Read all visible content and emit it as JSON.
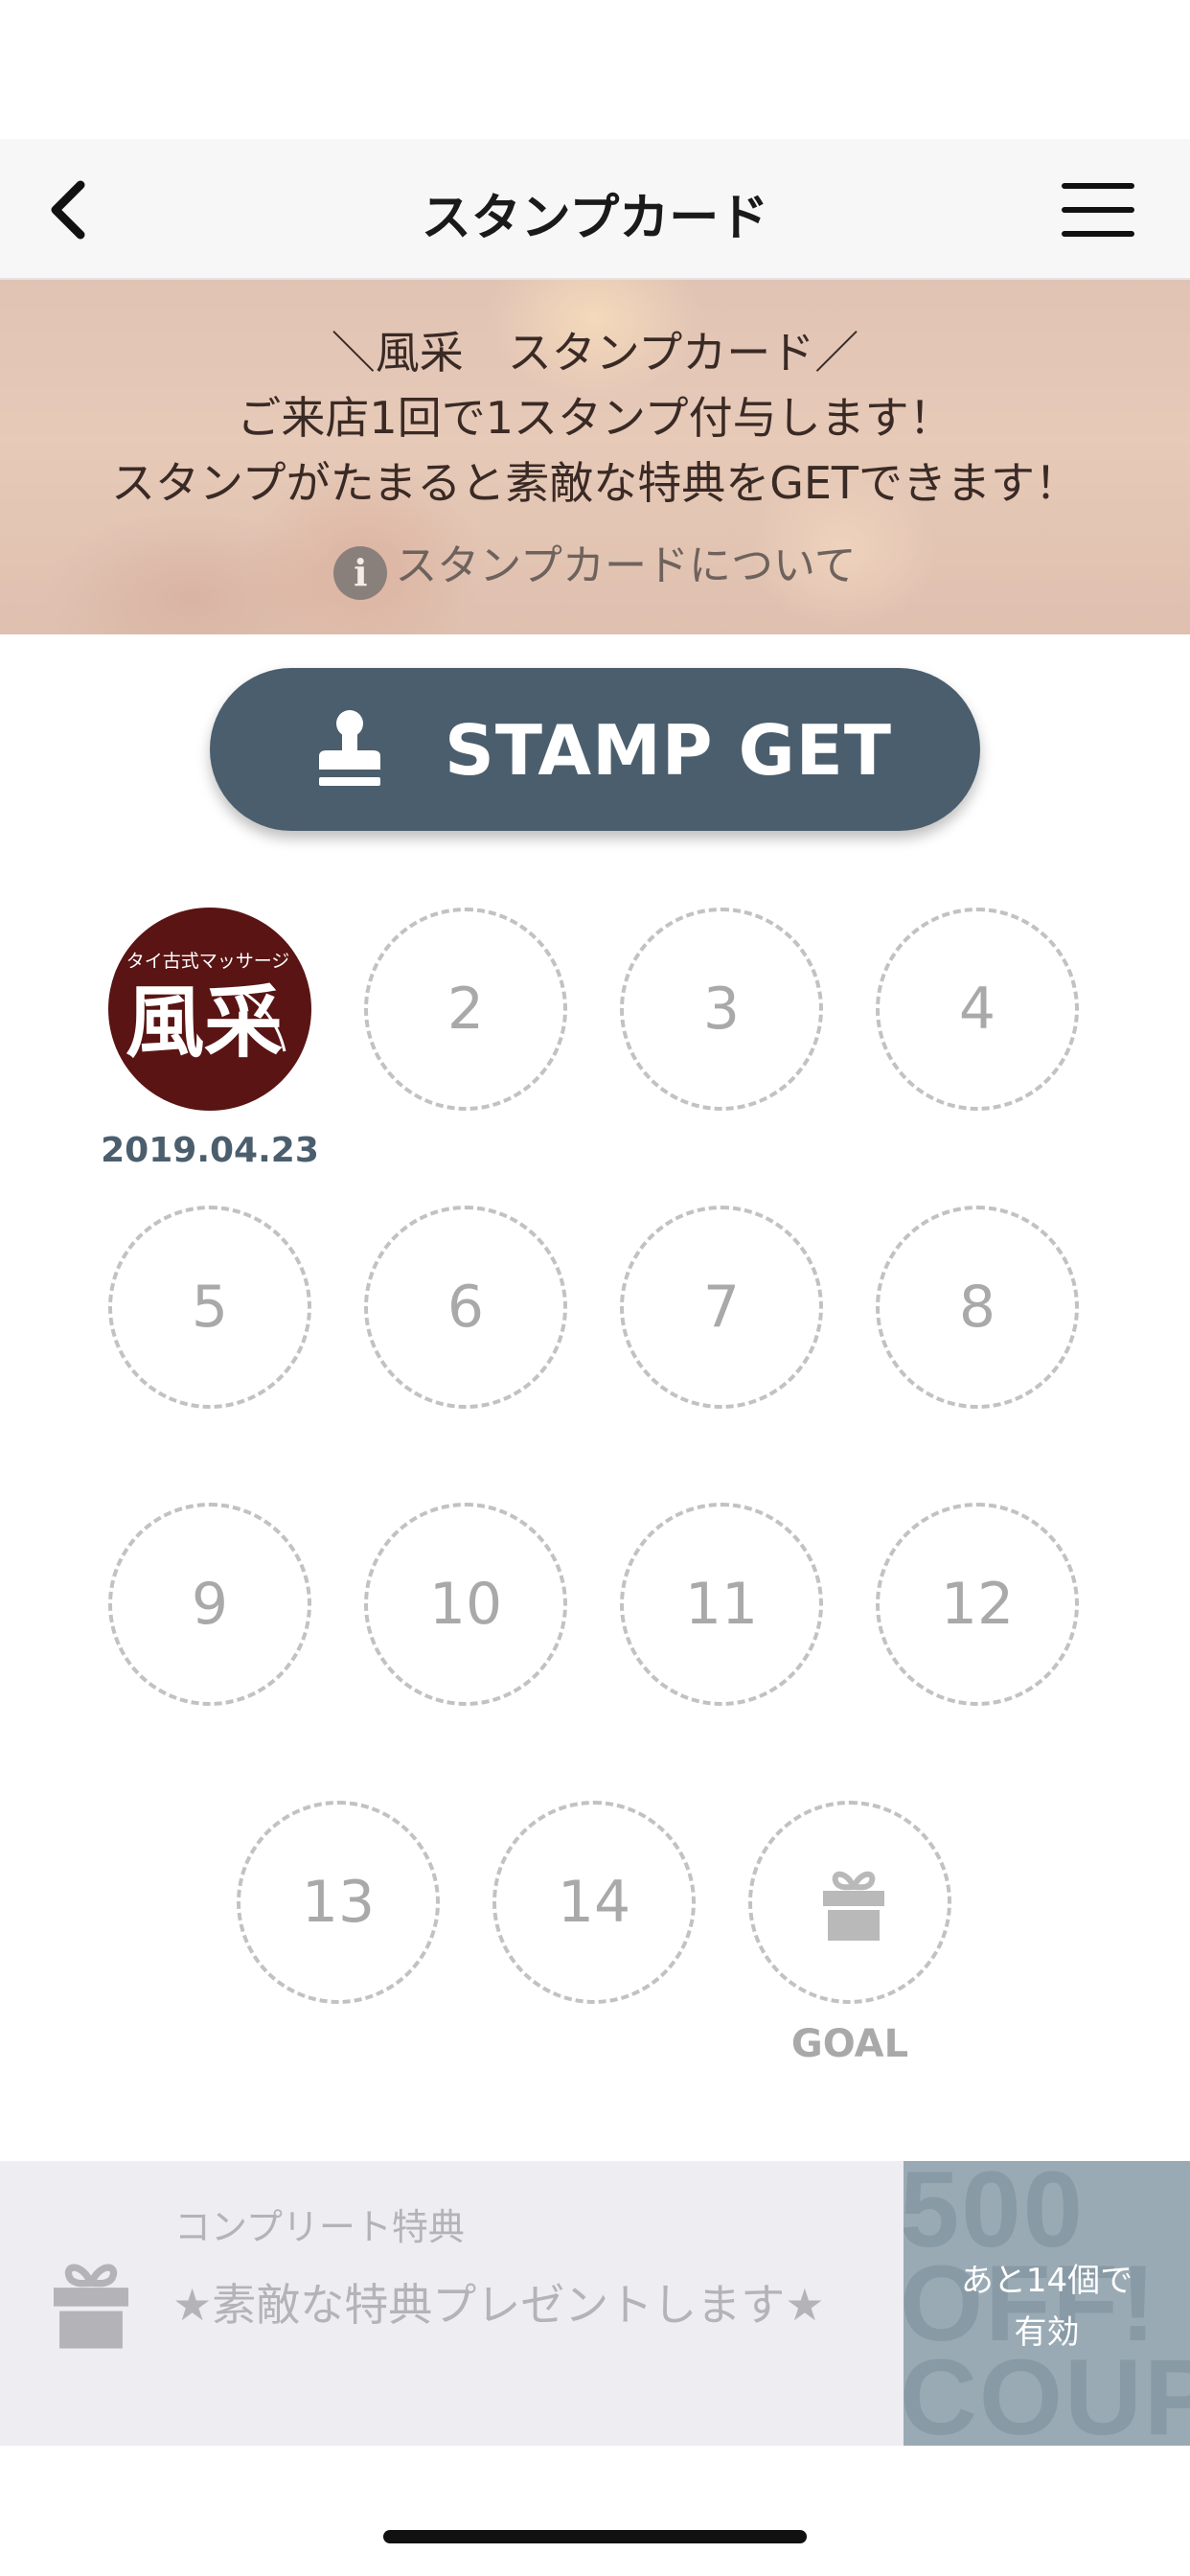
{
  "nav": {
    "title": "スタンプカード",
    "back_icon": "chevron-left-icon",
    "menu_icon": "hamburger-menu-icon"
  },
  "banner": {
    "line1": "＼風采　スタンプカード／",
    "line2": "ご来店1回で1スタンプ付与します！",
    "line3": "スタンプがたまると素敵な特典をGETできます！",
    "info_icon_glyph": "i",
    "about_link": "スタンプカードについて"
  },
  "stamp_button": {
    "label": "STAMP GET",
    "icon": "stamp-icon"
  },
  "stamps": {
    "stamped": [
      {
        "logo_top": "タイ古式マッサージ",
        "logo_main": "風采",
        "date": "2019.04.23"
      }
    ],
    "slots": [
      "2",
      "3",
      "4",
      "5",
      "6",
      "7",
      "8",
      "9",
      "10",
      "11",
      "12",
      "13",
      "14"
    ],
    "goal_label": "GOAL",
    "goal_icon": "gift-icon"
  },
  "complete": {
    "label": "コンプリート特典",
    "description": "★素敵な特典プレゼントします★",
    "icon": "gift-icon"
  },
  "coupon": {
    "bg_lines": [
      "500",
      "OFF!",
      "COUPON"
    ],
    "remaining_text": "あと14個で",
    "valid_text": "有効"
  },
  "colors": {
    "button": "#4b5e6d",
    "stamp": "#5a1414",
    "dashed": "#c2c2c2",
    "panel": "#ededf2"
  }
}
